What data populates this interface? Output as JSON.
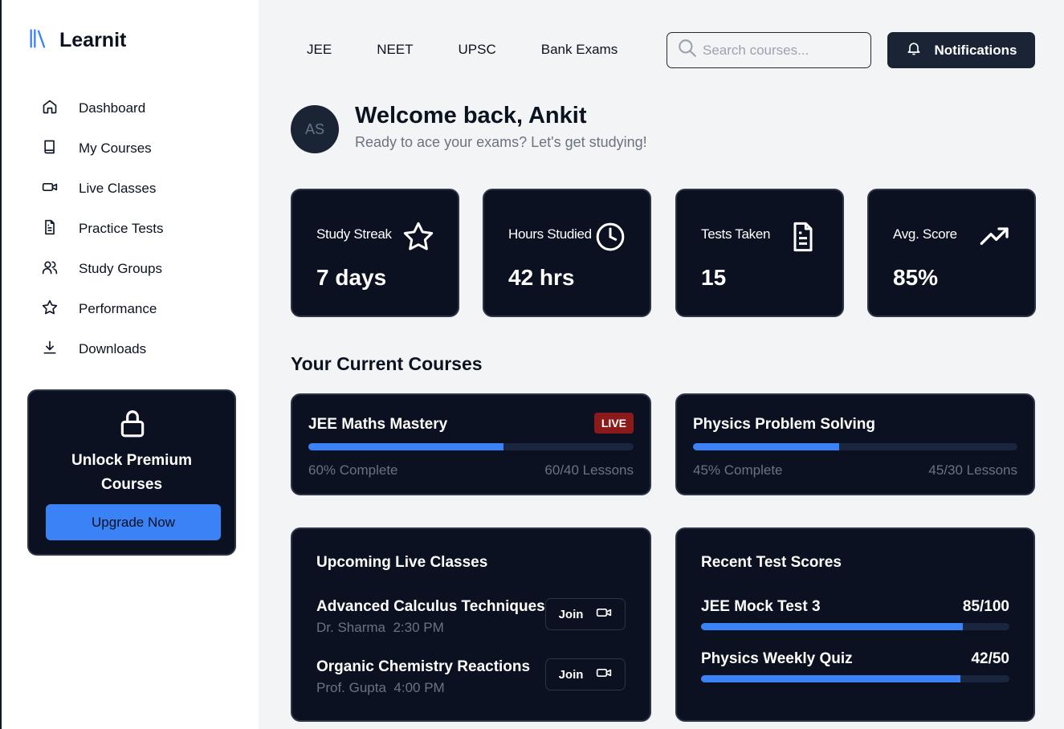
{
  "app": {
    "name": "Learnit"
  },
  "sidebar": {
    "items": [
      {
        "label": "Dashboard",
        "icon": "home-icon"
      },
      {
        "label": "My Courses",
        "icon": "book-icon"
      },
      {
        "label": "Live Classes",
        "icon": "video-icon"
      },
      {
        "label": "Practice Tests",
        "icon": "file-text-icon"
      },
      {
        "label": "Study Groups",
        "icon": "users-icon"
      },
      {
        "label": "Performance",
        "icon": "star-icon"
      },
      {
        "label": "Downloads",
        "icon": "download-icon"
      }
    ],
    "promo": {
      "title": "Unlock Premium Courses",
      "button": "Upgrade Now"
    }
  },
  "topnav": {
    "links": [
      "JEE",
      "NEET",
      "UPSC",
      "Bank Exams"
    ],
    "search_placeholder": "Search courses...",
    "notifications_label": "Notifications"
  },
  "welcome": {
    "avatar_initials": "AS",
    "title": "Welcome back, Ankit",
    "subtitle": "Ready to ace your exams? Let's get studying!"
  },
  "stats": [
    {
      "label": "Study Streak",
      "value": "7 days",
      "icon": "star-icon"
    },
    {
      "label": "Hours Studied",
      "value": "42 hrs",
      "icon": "clock-icon"
    },
    {
      "label": "Tests Taken",
      "value": "15",
      "icon": "file-text-icon"
    },
    {
      "label": "Avg. Score",
      "value": "85%",
      "icon": "trending-up-icon"
    }
  ],
  "courses": {
    "title": "Your Current Courses",
    "items": [
      {
        "title": "JEE Maths Mastery",
        "badge": "LIVE",
        "progress": 60,
        "progress_label": "60% Complete",
        "lessons": "60/40 Lessons"
      },
      {
        "title": "Physics Problem Solving",
        "badge": "",
        "progress": 45,
        "progress_label": "45% Complete",
        "lessons": "45/30 Lessons"
      }
    ]
  },
  "live_classes": {
    "title": "Upcoming Live Classes",
    "join_label": "Join",
    "items": [
      {
        "name": "Advanced Calculus Techniques",
        "teacher": "Dr. Sharma",
        "time": "2:30 PM"
      },
      {
        "name": "Organic Chemistry Reactions",
        "teacher": "Prof. Gupta",
        "time": "4:00 PM"
      }
    ]
  },
  "test_scores": {
    "title": "Recent Test Scores",
    "items": [
      {
        "name": "JEE Mock Test 3",
        "score": "85/100",
        "fraction": 0.85
      },
      {
        "name": "Physics Weekly Quiz",
        "score": "42/50",
        "fraction": 0.84
      }
    ]
  },
  "colors": {
    "accent": "#3b82f6",
    "card": "#0b1120",
    "live_badge": "#8b1a1a"
  }
}
